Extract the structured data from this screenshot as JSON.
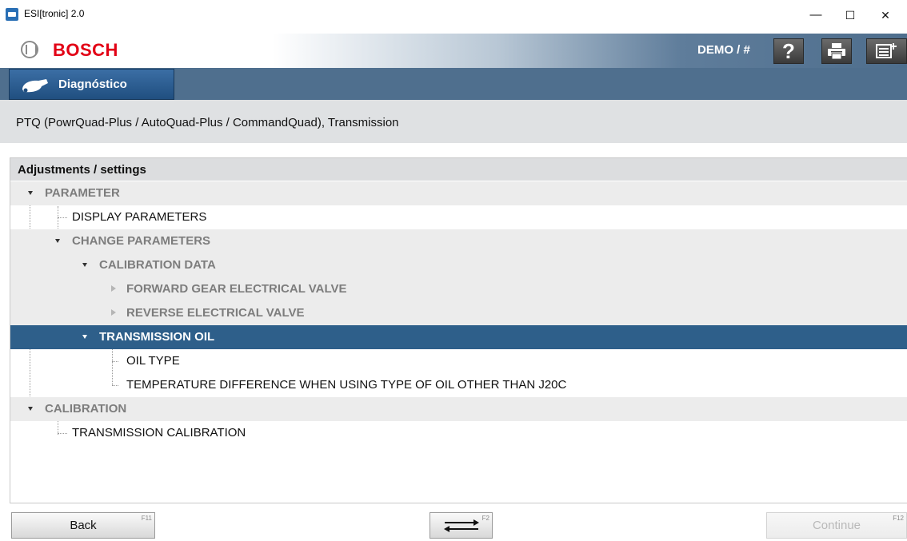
{
  "window": {
    "title": "ESI[tronic] 2.0",
    "minimize": "—",
    "maximize": "☐",
    "close": "✕"
  },
  "header": {
    "brand": "BOSCH",
    "user": "DEMO / #",
    "help_label": "?",
    "icons": [
      "help-icon",
      "print-icon",
      "menu-list-icon"
    ]
  },
  "tabs": [
    {
      "label": "Diagnóstico",
      "icon": "car-plug-icon",
      "active": true
    }
  ],
  "vehicle": {
    "description": "PTQ (PowrQuad-Plus / AutoQuad-Plus / CommandQuad), Transmission"
  },
  "panel": {
    "title": "Adjustments / settings",
    "tree": [
      {
        "label": "PARAMETER",
        "level": 0,
        "type": "group",
        "state": "expanded"
      },
      {
        "label": "DISPLAY PARAMETERS",
        "level": 1,
        "type": "leaf"
      },
      {
        "label": "CHANGE PARAMETERS",
        "level": 1,
        "type": "group",
        "state": "expanded"
      },
      {
        "label": "CALIBRATION DATA",
        "level": 2,
        "type": "group",
        "state": "expanded"
      },
      {
        "label": "FORWARD GEAR ELECTRICAL VALVE",
        "level": 3,
        "type": "group",
        "state": "collapsed"
      },
      {
        "label": "REVERSE ELECTRICAL VALVE",
        "level": 3,
        "type": "group",
        "state": "collapsed"
      },
      {
        "label": "TRANSMISSION OIL",
        "level": 2,
        "type": "group",
        "state": "expanded",
        "selected": true
      },
      {
        "label": "OIL TYPE",
        "level": 3,
        "type": "leaf"
      },
      {
        "label": "TEMPERATURE DIFFERENCE WHEN USING TYPE OF OIL OTHER THAN J20C",
        "level": 3,
        "type": "leaf"
      },
      {
        "label": "CALIBRATION",
        "level": 0,
        "type": "group",
        "state": "expanded"
      },
      {
        "label": "TRANSMISSION CALIBRATION",
        "level": 1,
        "type": "leaf"
      }
    ]
  },
  "footer": {
    "back": {
      "label": "Back",
      "fkey": "F11"
    },
    "swap": {
      "fkey": "F2",
      "icon": "swap-arrows-icon"
    },
    "continue": {
      "label": "Continue",
      "fkey": "F12",
      "enabled": false
    }
  },
  "colors": {
    "brand_red": "#e20015",
    "selection": "#2e5f8a",
    "tab_blue": "#204f80",
    "header_steel": "#4f6f8e"
  }
}
